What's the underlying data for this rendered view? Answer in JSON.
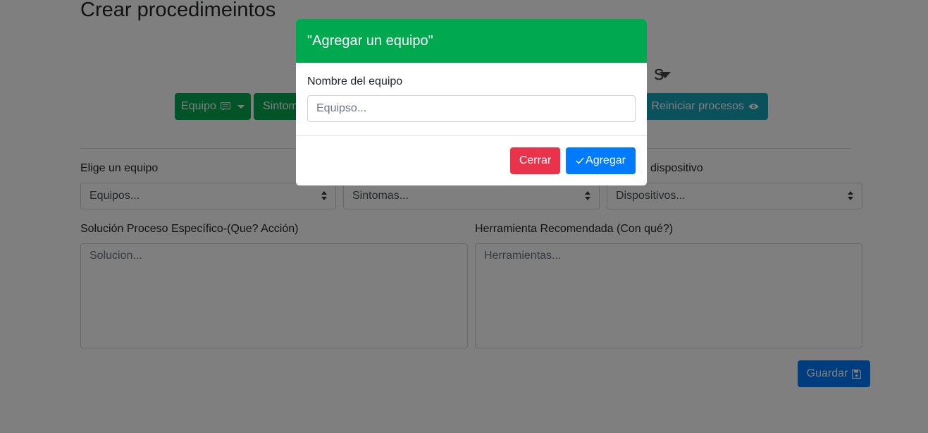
{
  "page": {
    "title": "Crear procedimeintos",
    "heading_fragment": "s"
  },
  "toolbar": {
    "equipo_label": "Equipo",
    "sintomas_label": "Sintom",
    "reiniciar_label": "Reiniciar procesos"
  },
  "form": {
    "equipo_label": "Elige un equipo",
    "equipo_select": "Equipos...",
    "sintomas_select": "Sintomas...",
    "dispositivo_label": "dispositivo",
    "dispositivo_select": "Dispositivos...",
    "solucion_label": "Solución Proceso Específico-(Que? Acción)",
    "solucion_placeholder": "Solucion...",
    "herramienta_label": "Herramienta Recomendada (Con qué?)",
    "herramienta_placeholder": "Herramientas...",
    "guardar_label": "Guardar"
  },
  "modal": {
    "title": "\"Agregar un equipo\"",
    "field_label": "Nombre del equipo",
    "field_placeholder": "Equipso...",
    "close_label": "Cerrar",
    "add_label": "Agregar"
  },
  "colors": {
    "green": "#00a84f",
    "teal": "#17a2b8",
    "blue": "#007bff",
    "red": "#e8334a"
  },
  "icons": [
    "comment-icon",
    "eye-icon",
    "save-icon",
    "check-icon",
    "caret-down-icon",
    "select-arrows-icon"
  ]
}
